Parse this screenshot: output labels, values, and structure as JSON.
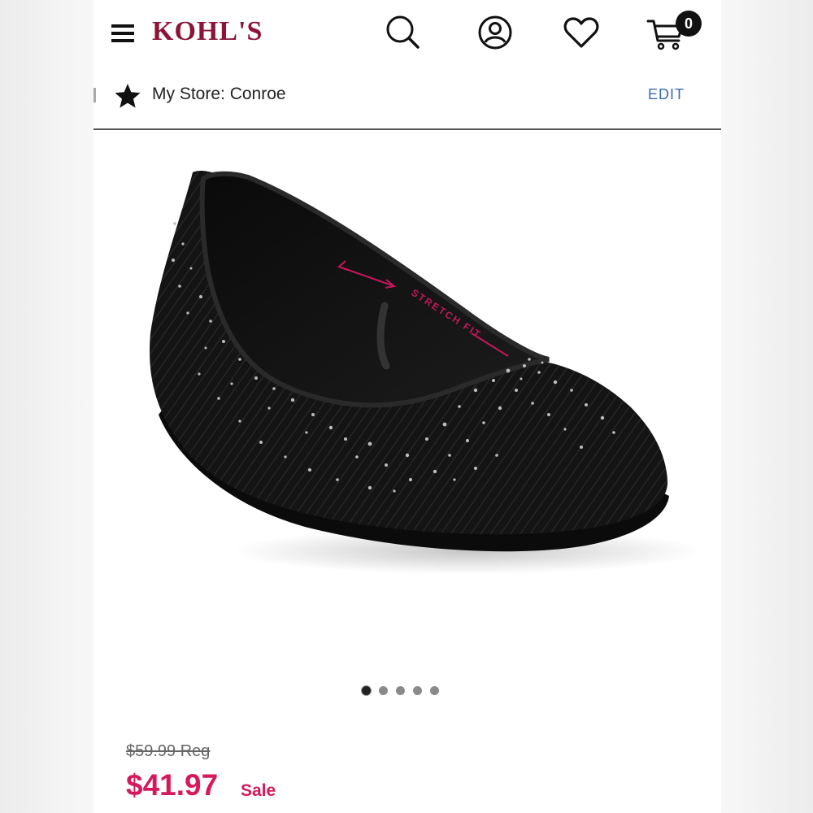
{
  "header": {
    "logo": "KOHL'S",
    "cart_count": "0",
    "icons": [
      "menu-icon",
      "search-icon",
      "account-icon",
      "heart-icon",
      "cart-icon"
    ]
  },
  "store": {
    "label": "My Store: Conroe",
    "edit_label": "EDIT"
  },
  "product": {
    "image_text": "STRETCH FIT",
    "carousel_total": 5,
    "carousel_active": 1,
    "reg_price": "$59.99 Reg",
    "sale_price": "$41.97",
    "sale_label": "Sale"
  },
  "colors": {
    "brand": "#8b1538",
    "sale": "#d6195c",
    "link": "#3b6aa8"
  }
}
